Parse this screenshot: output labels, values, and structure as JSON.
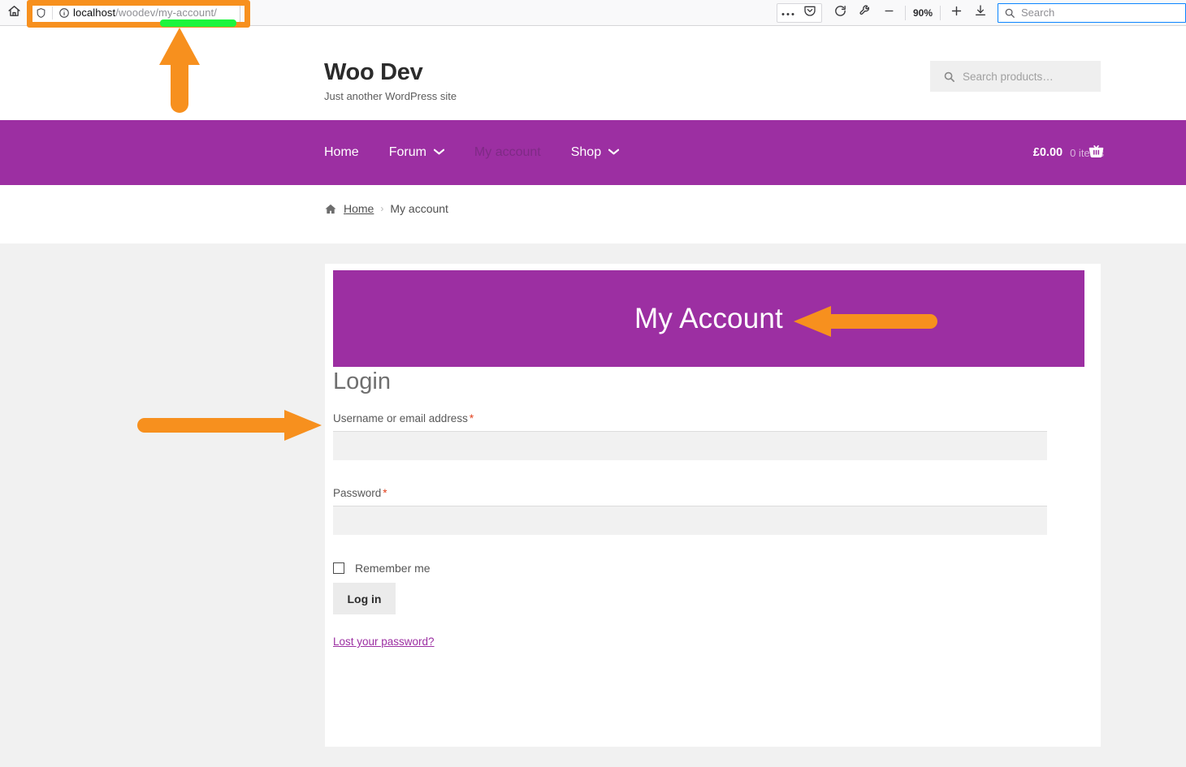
{
  "browser": {
    "home_icon": "home-icon",
    "url_shield_icon": "tracking-protection-shield-icon",
    "url_info_icon": "site-info-icon",
    "url_host": "localhost",
    "url_path": "/woodev/my-account/",
    "url_full": "localhost/woodev/my-account/",
    "menu_icon": "ellipsis-menu-icon",
    "pocket_icon": "pocket-icon",
    "reload_icon": "reload-icon",
    "devtools_icon": "wrench-icon",
    "zoom_out_icon": "minus-icon",
    "zoom_level": "90%",
    "zoom_in_icon": "plus-icon",
    "downloads_icon": "download-icon",
    "search_placeholder": "Search",
    "search_icon": "search-icon"
  },
  "site": {
    "title": "Woo Dev",
    "tagline": "Just another WordPress site",
    "product_search_placeholder": "Search products…",
    "product_search_icon": "search-icon"
  },
  "nav": {
    "items": [
      {
        "label": "Home",
        "has_caret": false,
        "current": false
      },
      {
        "label": "Forum",
        "has_caret": true,
        "current": false
      },
      {
        "label": "My account",
        "has_caret": false,
        "current": true
      },
      {
        "label": "Shop",
        "has_caret": true,
        "current": false
      }
    ],
    "caret_icon": "chevron-down-icon",
    "cart_amount": "£0.00",
    "cart_items": "0 items",
    "cart_icon": "shopping-basket-icon"
  },
  "breadcrumb": {
    "home_icon": "home-icon",
    "home_label": "Home",
    "separator": "›",
    "current": "My account"
  },
  "account": {
    "banner_title": "My Account",
    "login_heading": "Login",
    "username_label": "Username or email address",
    "username_value": "",
    "username_placeholder": "",
    "password_label": "Password",
    "password_value": "",
    "password_placeholder": "",
    "required_mark": "*",
    "remember_label": "Remember me",
    "login_button": "Log in",
    "lost_password": "Lost your password?"
  },
  "annotations": {
    "arrow_url_bar": "orange-arrow-up",
    "arrow_my_account": "orange-arrow-left",
    "arrow_username_field": "orange-arrow-right",
    "url_highlight": "orange-rectangle",
    "url_underline": "green-highlight-bar"
  },
  "colors": {
    "brand_purple": "#9c2fa2",
    "annotation_orange": "#f7901e",
    "annotation_green": "#1cf53c",
    "page_background": "#f1f1f1",
    "required_red": "#e2401c"
  }
}
